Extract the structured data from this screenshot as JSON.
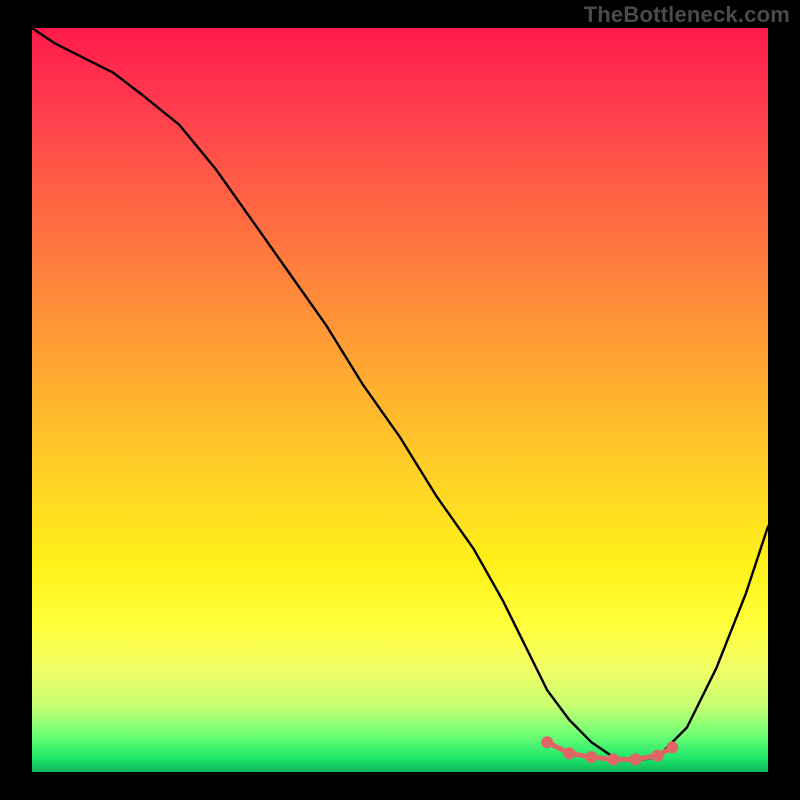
{
  "watermark": "TheBottleneck.com",
  "colors": {
    "page_bg": "#000000",
    "watermark": "#4a4a4a",
    "curve": "#000000",
    "markers": "#e06666"
  },
  "chart_data": {
    "type": "line",
    "title": "",
    "xlabel": "",
    "ylabel": "",
    "xlim": [
      0,
      100
    ],
    "ylim": [
      0,
      100
    ],
    "background": "gradient-heatmap",
    "series": [
      {
        "name": "bottleneck-curve",
        "x": [
          0,
          3,
          7,
          11,
          15,
          20,
          25,
          30,
          35,
          40,
          45,
          50,
          55,
          60,
          64,
          67,
          70,
          73,
          76,
          79,
          82,
          85,
          89,
          93,
          97,
          100
        ],
        "values": [
          100,
          98,
          96,
          94,
          91,
          87,
          81,
          74,
          67,
          60,
          52,
          45,
          37,
          30,
          23,
          17,
          11,
          7,
          4,
          2,
          1.5,
          2,
          6,
          14,
          24,
          33
        ]
      }
    ],
    "markers": {
      "name": "sweet-spot",
      "x": [
        70,
        73,
        76,
        79,
        82,
        85,
        87
      ],
      "values": [
        4.0,
        2.5,
        2.0,
        1.7,
        1.7,
        2.2,
        3.3
      ]
    },
    "annotations": [],
    "grid": false,
    "legend": false
  }
}
